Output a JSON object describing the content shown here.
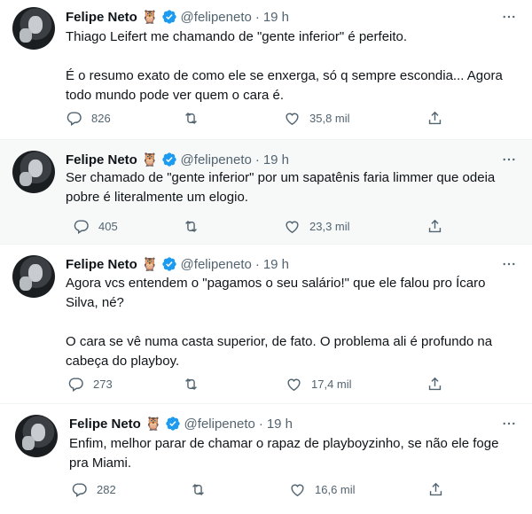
{
  "tweets": [
    {
      "name": "Felipe Neto",
      "emoji": "🦉",
      "handle": "@felipeneto",
      "time": "19 h",
      "text": "Thiago Leifert me chamando de \"gente inferior\" é perfeito.\n\nÉ o resumo exato de como ele se enxerga, só q sempre escondia... Agora todo mundo pode ver quem o cara é.",
      "replies": "826",
      "likes": "35,8 mil"
    },
    {
      "name": "Felipe Neto",
      "emoji": "🦉",
      "handle": "@felipeneto",
      "time": "19 h",
      "text": "Ser chamado de \"gente inferior\" por um sapatênis faria limmer que odeia pobre é literalmente um elogio.",
      "replies": "405",
      "likes": "23,3 mil"
    },
    {
      "name": "Felipe Neto",
      "emoji": "🦉",
      "handle": "@felipeneto",
      "time": "19 h",
      "text": "Agora vcs entendem o \"pagamos o seu salário!\" que ele falou pro Ícaro Silva, né?\n\nO cara se vê numa casta superior, de fato. O problema ali é profundo na cabeça do playboy.",
      "replies": "273",
      "likes": "17,4 mil"
    },
    {
      "name": "Felipe Neto",
      "emoji": "🦉",
      "handle": "@felipeneto",
      "time": "19 h",
      "text": "Enfim, melhor parar de chamar o rapaz de playboyzinho, se não ele foge pra Miami.",
      "replies": "282",
      "likes": "16,6 mil"
    }
  ],
  "colors": {
    "verified": "#1d9bf0",
    "muted": "#536471",
    "text": "#0f1419"
  },
  "icons": [
    "reply-icon",
    "retweet-icon",
    "like-icon",
    "share-icon",
    "more-icon",
    "verified-badge-icon"
  ]
}
